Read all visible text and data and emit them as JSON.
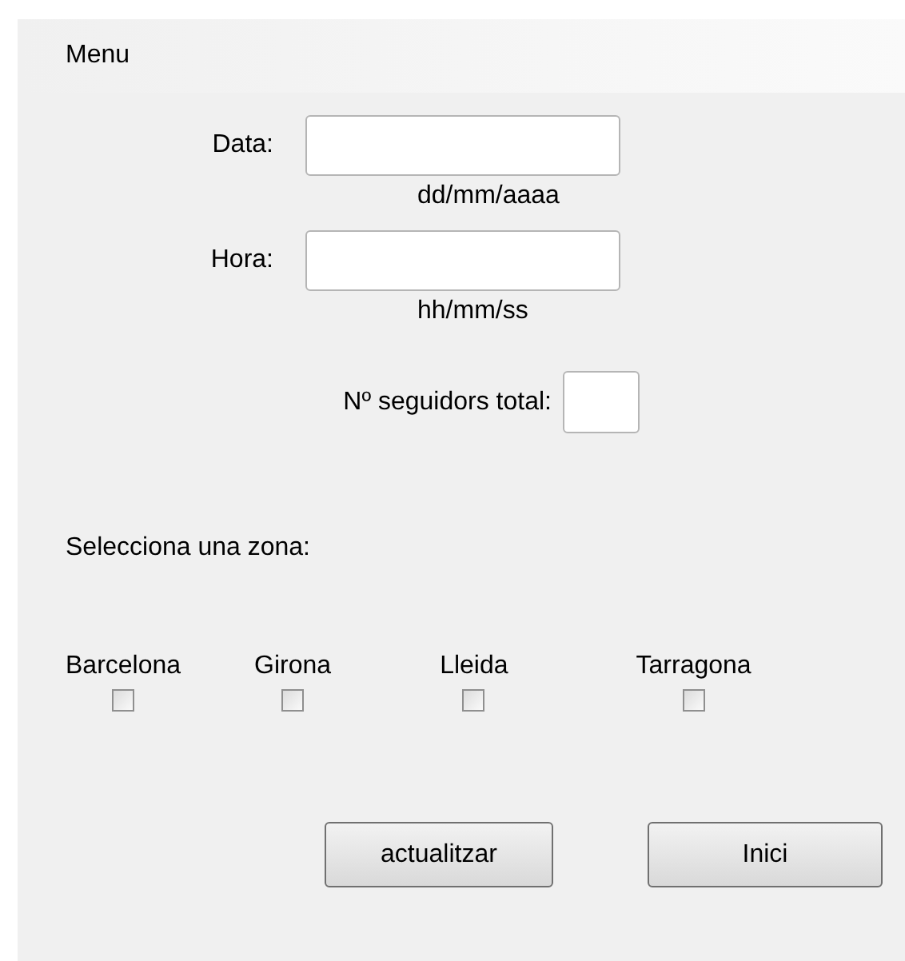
{
  "menu": {
    "items": [
      "Menu"
    ]
  },
  "fields": [
    {
      "label": "Data:",
      "hint": "dd/mm/aaaa"
    },
    {
      "label": "Hora:",
      "hint": "hh/mm/ss"
    }
  ],
  "followers": {
    "label": "Nº seguidors total:"
  },
  "zone_prompt": "Selecciona una zona:",
  "zones": [
    {
      "label": "Barcelona",
      "checked": false
    },
    {
      "label": "Girona",
      "checked": false
    },
    {
      "label": "Lleida",
      "checked": false
    },
    {
      "label": "Tarragona",
      "checked": false
    }
  ],
  "buttons": [
    "actualitzar",
    "Inici"
  ]
}
